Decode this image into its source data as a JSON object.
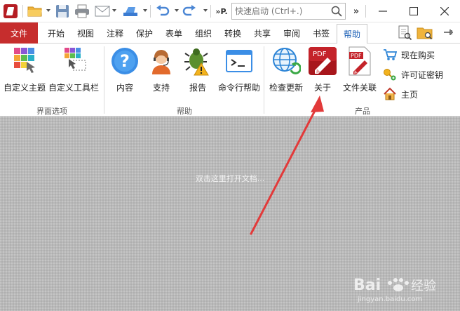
{
  "titlebar": {
    "truncated_label": "P.",
    "search_placeholder": "快速启动 (Ctrl+.)"
  },
  "tabs": {
    "file": "文件",
    "items": [
      "开始",
      "视图",
      "注释",
      "保护",
      "表单",
      "组织",
      "转换",
      "共享",
      "审阅",
      "书签",
      "帮助"
    ],
    "active": "帮助"
  },
  "ribbon": {
    "groups": {
      "interface": "界面选项",
      "help": "帮助",
      "product": "产品"
    },
    "buttons": {
      "custom_theme": "自定义主题",
      "custom_toolbar": "自定义工具栏",
      "contents": "内容",
      "support": "支持",
      "report": "报告",
      "cmdline_help": "命令行帮助",
      "check_update": "检查更新",
      "about": "关于",
      "file_assoc": "文件关联"
    },
    "small_buttons": {
      "buy_now": "现在购买",
      "license_key": "许可证密钥",
      "home": "主页"
    },
    "icon_text": {
      "pdf_about": "PDF",
      "pdf_assoc": "PDF"
    }
  },
  "document": {
    "hint": "双击这里打开文档..."
  },
  "watermark": {
    "brand": "Bai",
    "brand_suffix": "经验",
    "url": "jingyan.baidu.com"
  },
  "colors": {
    "file_tab": "#c62d2d",
    "active_tab_text": "#1b5fb6",
    "annotation_arrow": "#e23a3a",
    "doc_bg": "#b9b9b9"
  }
}
